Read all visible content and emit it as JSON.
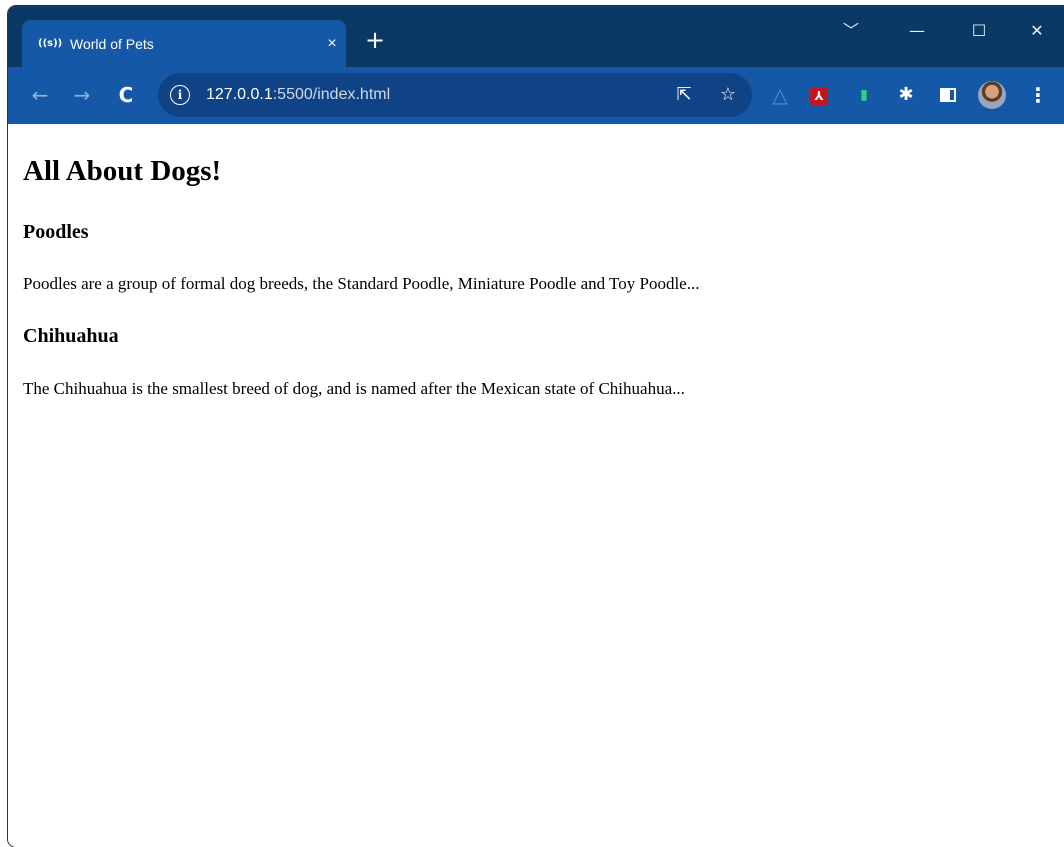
{
  "browser": {
    "tab": {
      "favicon_text": "((s))",
      "title": "World of Pets",
      "close_glyph": "×"
    },
    "new_tab_glyph": "+",
    "window_controls": {
      "dropdown": "﹀",
      "minimize": "—",
      "maximize": "☐",
      "close": "✕"
    },
    "nav": {
      "back": "←",
      "forward": "→",
      "reload": "C"
    },
    "address_bar": {
      "info_glyph": "i",
      "host": "127.0.0.1",
      "path": ":5500/index.html"
    },
    "omnibox_icons": {
      "share": "⇱",
      "bookmark": "☆"
    },
    "extensions": {
      "drive": "△",
      "pdf": "⅄",
      "green": "▮",
      "puzzle": "✱",
      "menu": "⋮"
    }
  },
  "page": {
    "heading": "All About Dogs!",
    "sections": [
      {
        "title": "Poodles",
        "text": "Poodles are a group of formal dog breeds, the Standard Poodle, Miniature Poodle and Toy Poodle..."
      },
      {
        "title": "Chihuahua",
        "text": "The Chihuahua is the smallest breed of dog, and is named after the Mexican state of Chihuahua..."
      }
    ]
  }
}
